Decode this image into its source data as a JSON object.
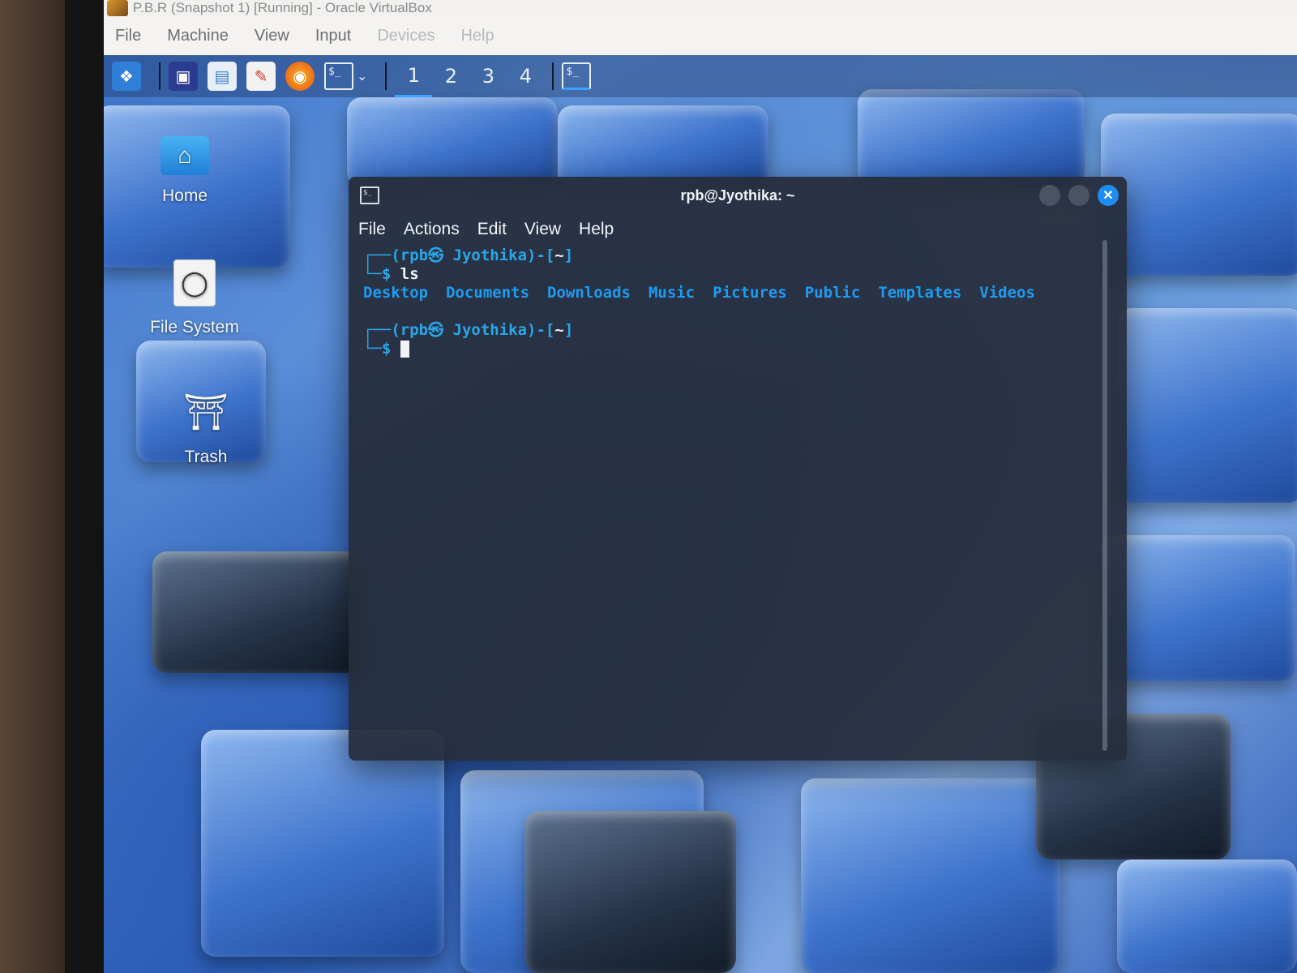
{
  "vbox": {
    "title": "P.B.R (Snapshot 1) [Running] - Oracle VirtualBox",
    "menu": [
      "File",
      "Machine",
      "View",
      "Input",
      "Devices",
      "Help"
    ]
  },
  "panel": {
    "workspaces": [
      "1",
      "2",
      "3",
      "4"
    ],
    "active_workspace": "1"
  },
  "desktop": {
    "icons": [
      {
        "label": "Home",
        "icon": "home-folder-icon"
      },
      {
        "label": "File System",
        "icon": "drive-icon"
      },
      {
        "label": "Trash",
        "icon": "trash-icon"
      }
    ]
  },
  "terminal": {
    "title": "rpb@Jyothika: ~",
    "menu": [
      "File",
      "Actions",
      "Edit",
      "View",
      "Help"
    ],
    "prompt_user": "rpb㉿ Jyothika",
    "prompt_dir": "~",
    "command": "ls",
    "ls_output": [
      "Desktop",
      "Documents",
      "Downloads",
      "Music",
      "Pictures",
      "Public",
      "Templates",
      "Videos"
    ],
    "colors": {
      "accent": "#2aa6e8",
      "close_button": "#1e8cf0"
    }
  }
}
